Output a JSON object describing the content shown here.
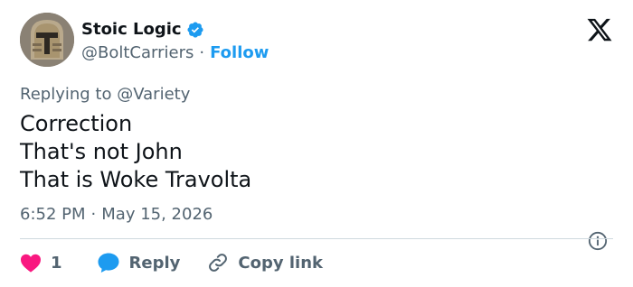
{
  "tweet": {
    "display_name": "Stoic Logic",
    "handle": "@BoltCarriers",
    "separator": "·",
    "follow_label": "Follow",
    "replying_prefix": "Replying to",
    "replying_to": "@Variety",
    "lines": [
      "Correction",
      "That's not John",
      "That is Woke Travolta"
    ],
    "time": "6:52 PM",
    "date": "May 15, 2026"
  },
  "actions": {
    "like_count": "1",
    "reply_label": "Reply",
    "copy_link_label": "Copy link"
  },
  "colors": {
    "accent": "#1d9bf0",
    "like": "#f91880",
    "text": "#0f1419",
    "muted": "#536471"
  },
  "icons": [
    "verified-badge-icon",
    "x-logo-icon",
    "info-icon",
    "heart-icon",
    "speech-bubble-icon",
    "link-icon"
  ]
}
